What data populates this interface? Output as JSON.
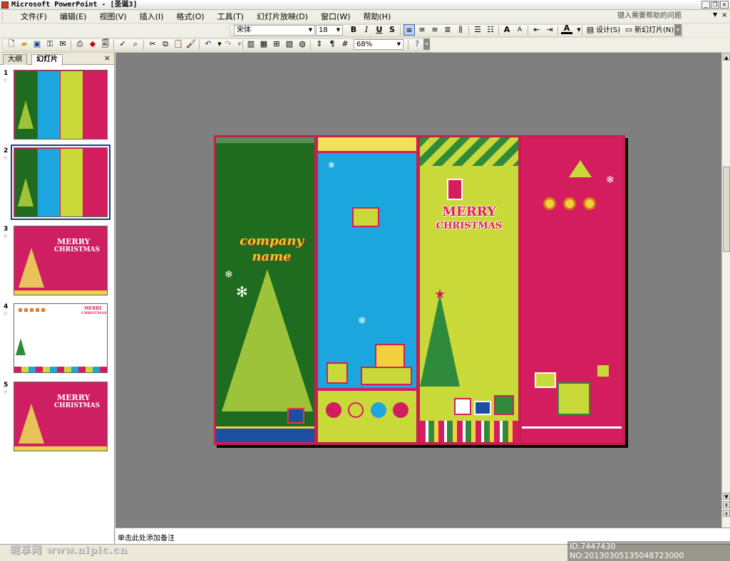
{
  "window": {
    "title": "Microsoft PowerPoint - [圣诞3]",
    "controls": [
      "_",
      "❐",
      "×"
    ]
  },
  "menu": {
    "items": [
      "文件(F)",
      "编辑(E)",
      "视图(V)",
      "插入(I)",
      "格式(O)",
      "工具(T)",
      "幻灯片放映(D)",
      "窗口(W)",
      "帮助(H)"
    ],
    "help_placeholder": "键入需要帮助的问题"
  },
  "toolbar": {
    "font_name": "宋体",
    "font_size": "18",
    "bold": "B",
    "italic": "I",
    "underline": "U",
    "shadow": "S",
    "design_label": "设计(S)",
    "new_slide_label": "新幻灯片(N)",
    "zoom": "68%"
  },
  "left_panel": {
    "tab_outline": "大纲",
    "tab_slides": "幻灯片",
    "close": "×",
    "slides": [
      {
        "num": "1",
        "star": "☆"
      },
      {
        "num": "2",
        "star": "☆"
      },
      {
        "num": "3",
        "star": "☆"
      },
      {
        "num": "4",
        "star": "☆"
      },
      {
        "num": "5",
        "star": "☆"
      }
    ],
    "thumb_texts": {
      "merry": "MERRY",
      "christmas": "CHRISTMAS"
    }
  },
  "slide": {
    "company_line1": "company",
    "company_line2": "name",
    "merry": "MERRY",
    "christmas": "CHRISTMAS",
    "colors": {
      "frame": "#c71f4f",
      "green": "#1f6b1f",
      "blue": "#1ba6dd",
      "lime": "#c9d93a",
      "pink": "#d41d5e"
    }
  },
  "notes": {
    "placeholder": "单击此处添加备注"
  },
  "watermarks": {
    "left": "昵享网 www.nipic.cn",
    "id": "ID:7447430 NO:20130305135048723000"
  }
}
